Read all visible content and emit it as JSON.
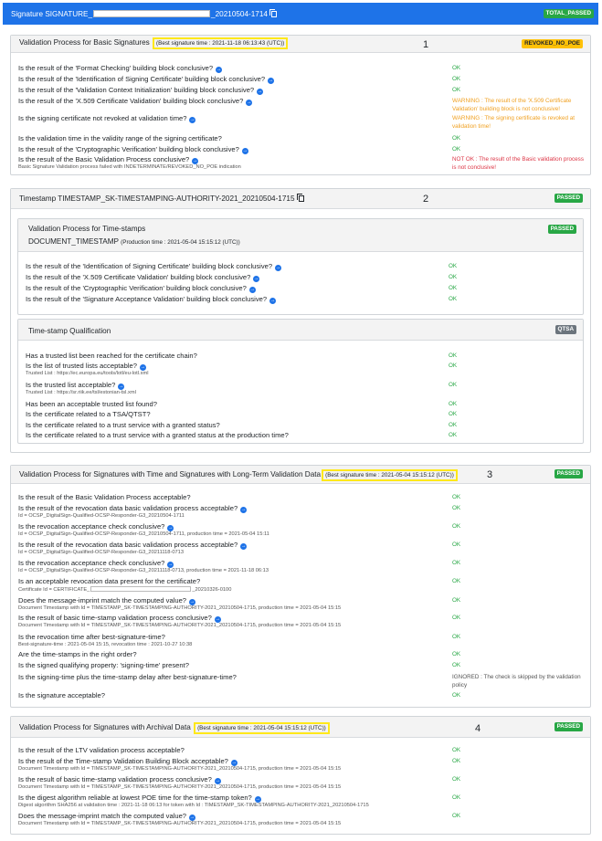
{
  "header": {
    "signature_prefix": "Signature SIGNATURE_",
    "signature_suffix": "_20210504-1714",
    "total_badge": "TOTAL_PASSED"
  },
  "basic": {
    "title": "Validation Process for Basic Signatures",
    "best_time": "(Best signature time : 2021-11-18 06:13:43 (UTC))",
    "number": "1",
    "badge": "REVOKED_NO_POE",
    "rows": [
      {
        "q": "Is the result of the 'Format Checking' building block conclusive?",
        "st": "OK",
        "status": "ok",
        "info": true
      },
      {
        "q": "Is the result of the 'Identification of Signing Certificate' building block conclusive?",
        "st": "OK",
        "status": "ok",
        "info": true
      },
      {
        "q": "Is the result of the 'Validation Context Initialization' building block conclusive?",
        "st": "OK",
        "status": "ok",
        "info": true
      },
      {
        "q": "Is the result of the 'X.509 Certificate Validation' building block conclusive?",
        "st": "WARNING : The result of the 'X.509 Certificate Validation' building block is not conclusive!",
        "status": "warn",
        "info": true
      },
      {
        "q": "Is the signing certificate not revoked at validation time?",
        "st": "WARNING : The signing certificate is revoked at validation time!",
        "status": "warn",
        "info": true
      },
      {
        "q": "Is the validation time in the validity range of the signing certificate?",
        "st": "OK",
        "status": "ok",
        "info": false
      },
      {
        "q": "Is the result of the 'Cryptographic Verification' building block conclusive?",
        "st": "OK",
        "status": "ok",
        "info": true
      },
      {
        "q": "Is the result of the Basic Validation Process conclusive?",
        "sub": "Basic Signature Validation process failed with INDETERMINATE/REVOKED_NO_POE indication",
        "st": "NOT OK : The result of the Basic validation process is not conclusive!",
        "status": "err",
        "info": true
      }
    ]
  },
  "timestamp": {
    "title": "Timestamp TIMESTAMP_SK-TIMESTAMPING-AUTHORITY-2021_20210504-1715",
    "number": "2",
    "badge": "PASSED",
    "vp": {
      "title": "Validation Process for Time-stamps",
      "subtitle": "DOCUMENT_TIMESTAMP",
      "production": "(Production time : 2021-05-04 15:15:12 (UTC))",
      "badge": "PASSED",
      "rows": [
        {
          "q": "Is the result of the 'Identification of Signing Certificate' building block conclusive?",
          "st": "OK",
          "status": "ok",
          "info": true
        },
        {
          "q": "Is the result of the 'X.509 Certificate Validation' building block conclusive?",
          "st": "OK",
          "status": "ok",
          "info": true
        },
        {
          "q": "Is the result of the 'Cryptographic Verification' building block conclusive?",
          "st": "OK",
          "status": "ok",
          "info": true
        },
        {
          "q": "Is the result of the 'Signature Acceptance Validation' building block conclusive?",
          "st": "OK",
          "status": "ok",
          "info": true
        }
      ]
    },
    "qual": {
      "title": "Time-stamp Qualification",
      "badge": "QTSA",
      "rows": [
        {
          "q": "Has a trusted list been reached for the certificate chain?",
          "st": "OK",
          "status": "ok",
          "info": false
        },
        {
          "q": "Is the list of trusted lists acceptable?",
          "sub": "Trusted List : https://ec.europa.eu/tools/lotl/eu-lotl.xml",
          "st": "OK",
          "status": "ok",
          "info": true
        },
        {
          "q": "Is the trusted list acceptable?",
          "sub": "Trusted List : https://sr.riik.ee/tsl/estonian-tsl.xml",
          "st": "OK",
          "status": "ok",
          "info": true
        },
        {
          "q": "Has been an acceptable trusted list found?",
          "st": "OK",
          "status": "ok",
          "info": false
        },
        {
          "q": "Is the certificate related to a TSA/QTST?",
          "st": "OK",
          "status": "ok",
          "info": false
        },
        {
          "q": "Is the certificate related to a trust service with a granted status?",
          "st": "OK",
          "status": "ok",
          "info": false
        },
        {
          "q": "Is the certificate related to a trust service with a granted status at the production time?",
          "st": "OK",
          "status": "ok",
          "info": false
        }
      ]
    }
  },
  "ltv": {
    "title": "Validation Process for Signatures with Time and Signatures with Long-Term Validation Data",
    "best_time": "(Best signature time : 2021-05-04 15:15:12 (UTC))",
    "number": "3",
    "badge": "PASSED",
    "rows": [
      {
        "q": "Is the result of the Basic Validation Process acceptable?",
        "st": "OK",
        "status": "ok",
        "info": false
      },
      {
        "q": "Is the result of the revocation data basic validation process acceptable?",
        "sub": "Id = OCSP_DigitalSign-Qualified-OCSP-Responder-G3_20210504-1711",
        "st": "OK",
        "status": "ok",
        "info": true
      },
      {
        "q": "Is the revocation acceptance check conclusive?",
        "sub": "Id = OCSP_DigitalSign-Qualified-OCSP-Responder-G3_20210504-1711, production time = 2021-05-04 15:11",
        "st": "OK",
        "status": "ok",
        "info": true
      },
      {
        "q": "Is the result of the revocation data basic validation process acceptable?",
        "sub": "Id = OCSP_DigitalSign-Qualified-OCSP-Responder-G3_20211118-0713",
        "st": "OK",
        "status": "ok",
        "info": true
      },
      {
        "q": "Is the revocation acceptance check conclusive?",
        "sub": "Id = OCSP_DigitalSign-Qualified-OCSP-Responder-G3_20211118-0713, production time = 2021-11-18 06:13",
        "st": "OK",
        "status": "ok",
        "info": true
      },
      {
        "q": "Is an acceptable revocation data present for the certificate?",
        "sub": "Certificate Id = CERTIFICATE_",
        "sub_suffix": "_20210326-0100",
        "st": "OK",
        "status": "ok",
        "info": false
      },
      {
        "q": "Does the message-imprint match the computed value?",
        "sub": "Document Timestamp with Id = TIMESTAMP_SK-TIMESTAMPING-AUTHORITY-2021_20210504-1715, production time = 2021-05-04 15:15",
        "st": "OK",
        "status": "ok",
        "info": true
      },
      {
        "q": "Is the result of basic time-stamp validation process conclusive?",
        "sub": "Document Timestamp with Id = TIMESTAMP_SK-TIMESTAMPING-AUTHORITY-2021_20210504-1715, production time = 2021-05-04 15:15",
        "st": "OK",
        "status": "ok",
        "info": true
      },
      {
        "q": "Is the revocation time after best-signature-time?",
        "sub": "Best-signature-time : 2021-05-04 15:15, revocation time : 2021-10-27 10:38",
        "st": "OK",
        "status": "ok",
        "info": false
      },
      {
        "q": "Are the time-stamps in the right order?",
        "st": "OK",
        "status": "ok",
        "info": false
      },
      {
        "q": "Is the signed qualifying property: 'signing-time' present?",
        "st": "OK",
        "status": "ok",
        "info": false
      },
      {
        "q": "Is the signing-time plus the time-stamp delay after best-signature-time?",
        "st": "IGNORED : The check is skipped by the validation policy",
        "status": "ign",
        "info": false
      },
      {
        "q": "Is the signature acceptable?",
        "st": "OK",
        "status": "ok",
        "info": false
      }
    ]
  },
  "archival": {
    "title": "Validation Process for Signatures with Archival Data",
    "best_time": "(Best signature time : 2021-05-04 15:15:12 (UTC))",
    "number": "4",
    "badge": "PASSED",
    "rows": [
      {
        "q": "Is the result of the LTV validation process acceptable?",
        "st": "OK",
        "status": "ok",
        "info": false
      },
      {
        "q": "Is the result of the Time-stamp Validation Building Block acceptable?",
        "sub": "Document Timestamp with Id = TIMESTAMP_SK-TIMESTAMPING-AUTHORITY-2021_20210504-1715, production time = 2021-05-04 15:15",
        "st": "OK",
        "status": "ok",
        "info": true
      },
      {
        "q": "Is the result of basic time-stamp validation process conclusive?",
        "sub": "Document Timestamp with Id = TIMESTAMP_SK-TIMESTAMPING-AUTHORITY-2021_20210504-1715, production time = 2021-05-04 15:15",
        "st": "OK",
        "status": "ok",
        "info": true
      },
      {
        "q": "Is the digest algorithm reliable at lowest POE time for the time-stamp token?",
        "sub": "Digest algorithm SHA256 at validation time : 2021-11-18 06:13 for token with Id : TIMESTAMP_SK-TIMESTAMPING-AUTHORITY-2021_20210504-1715",
        "st": "OK",
        "status": "ok",
        "info": true
      },
      {
        "q": "Does the message-imprint match the computed value?",
        "sub": "Document Timestamp with Id = TIMESTAMP_SK-TIMESTAMPING-AUTHORITY-2021_20210504-1715, production time = 2021-05-04 15:15",
        "st": "OK",
        "status": "ok",
        "info": true
      }
    ]
  }
}
